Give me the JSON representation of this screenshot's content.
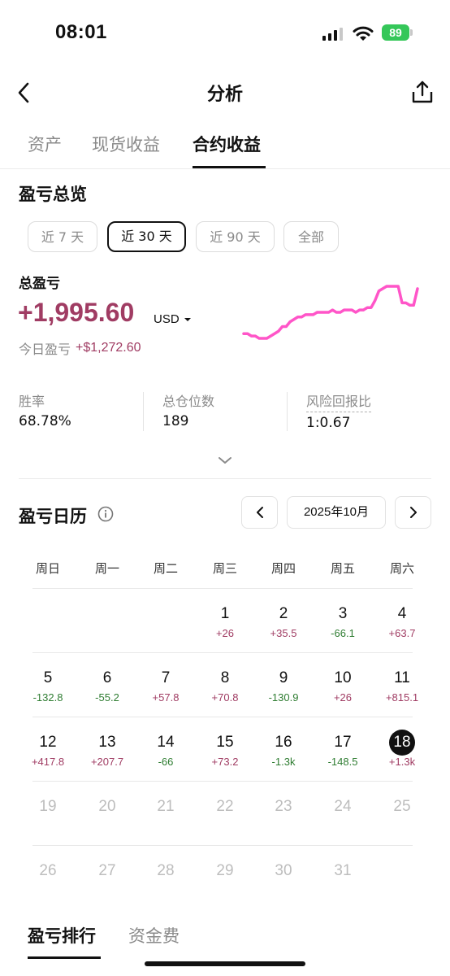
{
  "status_bar": {
    "time": "08:01",
    "battery": "89"
  },
  "header": {
    "title": "分析"
  },
  "tabs": [
    {
      "label": "资产"
    },
    {
      "label": "现货收益"
    },
    {
      "label": "合约收益"
    }
  ],
  "overview": {
    "title": "盈亏总览",
    "periods": [
      {
        "label": "近 7 天"
      },
      {
        "label": "近 30 天"
      },
      {
        "label": "近 90 天"
      },
      {
        "label": "全部"
      }
    ],
    "selected_period": "近 30 天",
    "total_pnl_label": "总盈亏",
    "total_pnl_value": "+1,995.60",
    "currency": "USD",
    "today_label": "今日盈亏",
    "today_value": "+$1,272.60",
    "stats": [
      {
        "label": "胜率",
        "value": "68.78%"
      },
      {
        "label": "总仓位数",
        "value": "189"
      },
      {
        "label": "风险回报比",
        "value": "1:0.67"
      }
    ],
    "sparkline_color": "#ff55c8",
    "sparkline_values": [
      0.0,
      0.0,
      -0.1,
      -0.1,
      -0.2,
      -0.2,
      -0.2,
      -0.1,
      0.0,
      0.1,
      0.3,
      0.3,
      0.5,
      0.6,
      0.7,
      0.7,
      0.8,
      0.8,
      0.8,
      0.9,
      0.9,
      0.9,
      0.9,
      1.0,
      0.9,
      0.9,
      1.0,
      1.0,
      1.0,
      0.9,
      1.0,
      1.0,
      1.1,
      1.1,
      1.4,
      1.8,
      1.9,
      2.0,
      2.0,
      2.0,
      2.0,
      1.3,
      1.3,
      1.2,
      1.2,
      1.9
    ]
  },
  "calendar": {
    "title": "盈亏日历",
    "month": "2025年10月",
    "weekdays": [
      "周日",
      "周一",
      "周二",
      "周三",
      "周四",
      "周五",
      "周六"
    ],
    "positive_color": "#a03c63",
    "negative_color": "#2f7d32",
    "today": 18,
    "days": [
      {
        "day": "1",
        "pnl": "+26"
      },
      {
        "day": "2",
        "pnl": "+35.5"
      },
      {
        "day": "3",
        "pnl": "-66.1"
      },
      {
        "day": "4",
        "pnl": "+63.7"
      },
      {
        "day": "5",
        "pnl": "-132.8"
      },
      {
        "day": "6",
        "pnl": "-55.2"
      },
      {
        "day": "7",
        "pnl": "+57.8"
      },
      {
        "day": "8",
        "pnl": "+70.8"
      },
      {
        "day": "9",
        "pnl": "-130.9"
      },
      {
        "day": "10",
        "pnl": "+26"
      },
      {
        "day": "11",
        "pnl": "+815.1"
      },
      {
        "day": "12",
        "pnl": "+417.8"
      },
      {
        "day": "13",
        "pnl": "+207.7"
      },
      {
        "day": "14",
        "pnl": "-66"
      },
      {
        "day": "15",
        "pnl": "+73.2"
      },
      {
        "day": "16",
        "pnl": "-1.3k"
      },
      {
        "day": "17",
        "pnl": "-148.5"
      },
      {
        "day": "18",
        "pnl": "+1.3k"
      },
      {
        "day": "19",
        "pnl": ""
      },
      {
        "day": "20",
        "pnl": ""
      },
      {
        "day": "21",
        "pnl": ""
      },
      {
        "day": "22",
        "pnl": ""
      },
      {
        "day": "23",
        "pnl": ""
      },
      {
        "day": "24",
        "pnl": ""
      },
      {
        "day": "25",
        "pnl": ""
      },
      {
        "day": "26",
        "pnl": ""
      },
      {
        "day": "27",
        "pnl": ""
      },
      {
        "day": "28",
        "pnl": ""
      },
      {
        "day": "29",
        "pnl": ""
      },
      {
        "day": "30",
        "pnl": ""
      },
      {
        "day": "31",
        "pnl": ""
      }
    ]
  },
  "bottom_tabs": [
    {
      "label": "盈亏排行"
    },
    {
      "label": "资金费"
    }
  ],
  "colors": {
    "profit": "#a03c63",
    "accent": "#111111",
    "battery": "#35c759"
  }
}
